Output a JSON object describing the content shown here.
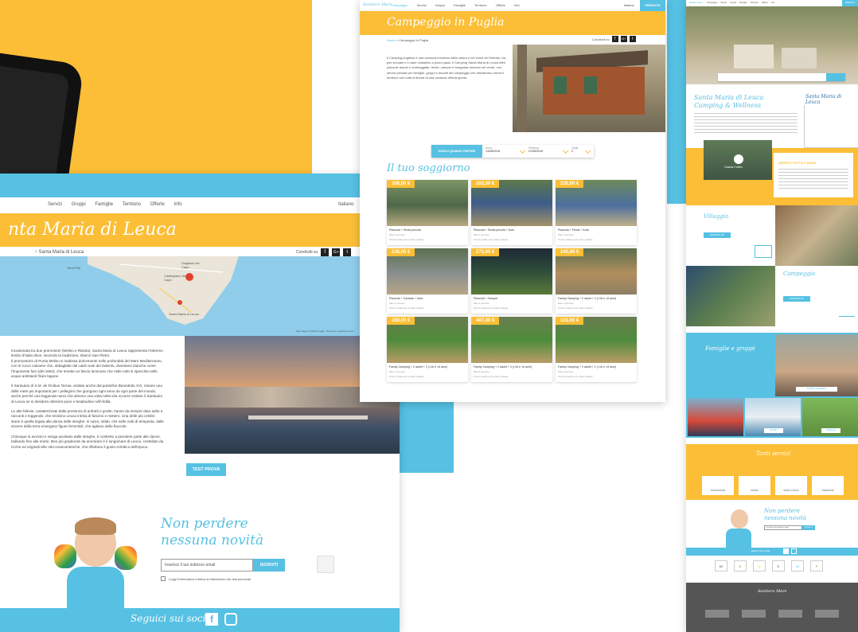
{
  "left": {
    "nav": [
      "Servizi",
      "Gruppi",
      "Famiglie",
      "Territorio",
      "Offerte",
      "Info"
    ],
    "lang": "Italiano",
    "title": "nta Maria di Leuca",
    "breadcrumb": "Santa Maria di Leuca",
    "share": "Condividi su",
    "share_icons": [
      "f",
      "G+",
      "t"
    ],
    "map_labels": [
      "Torre Pali",
      "Gagliano del Capo",
      "Castrignano del Capo",
      "Santa Maria di Leuca"
    ],
    "map_footer": "Dati mappa ©2018 Google · Termini e condizioni d'uso",
    "para1": "Incastonata tra due promontori (Meliso e Ristola), Santa Maria di Leuca rappresenta l'estremo lembo d'Italia dove, secondo la tradizione, sbarcò San Pietro.",
    "para2": "Il promontorio di Punta Meliso si inabissa dolcemente nelle profondità del Mare Mediterraneo, con le rocce calcaree che, abbagliate dal caldo sole del Salento, diventano bianche come l'imponente faro (del 1864), che emette un fascio luminoso che nelle notti si specchia nelle acque antistanti l'ilare lagune.",
    "para3": "Il Santuario di S.M. de Finibus Terrae, visitato anche dal pontefice Benedetto XVI, rimane una delle mete più importanti per i pellegrini che giungono ogni anno da ogni parte del mondo, anche perché una leggenda narra che almeno una volta nella vita occorre visitare il Santuario di Leuca se si desidera ottenere pace e beatitudine nell'Aldilà.",
    "para4": "Le alte falesie, caratterizzate dalla presenza di anfratti e grotte, hanno da sempre dato adito a racconti e leggende, che rendono Leuca intrisa di fascino e mistero. Una delle più celebri storie è quella legata alla danza delle streghe: si narra, infatti, che nelle notti di tempesta, dalle viscere della terra emergano figure femminili, che agitano delle fiaccole.",
    "para5": "Chiunque si avvicini e venga avvistato dalle streghe, è costretto a prendere parte alle danze, ballando fino alla morte. Ben più gradevole da ammirare è il lungomare di Leuca, costellato da ricche ed originali ville otto-novecentesche, che riflettono il gusto eclettico dell'epoca.",
    "test_button": "TEST PROVA",
    "newsletter_title_1": "Non perdere",
    "newsletter_title_2": "nessuna novità",
    "email_placeholder": "Inserisci il tuo indirizzo email",
    "subscribe": "ISCRIVITI",
    "privacy": "Leggi l'informativa relativa al trattamento dei dati personali",
    "social": "Seguici sui social"
  },
  "middle": {
    "logo": "Sentiero Mare",
    "nav": [
      "Campeggio",
      "Servizi",
      "Gruppi",
      "Famiglie",
      "Territorio",
      "Offerte",
      "Info"
    ],
    "lang": "Italiano",
    "book": "PRENOTA",
    "title": "Campeggio in Puglia",
    "breadcrumb_home": "Home",
    "breadcrumb": "Campeggio in Puglia",
    "share": "Condividi su",
    "share_icons": [
      "f",
      "G+",
      "t"
    ],
    "intro": "Il Camping pugliese è una vacanza immersa nella natura e nei suoni del Salento, tra pini secolari e il mare cristallino a pochi passi. Il Camping Santa Maria di Leuca offre piazzole ampie e ombreggiate, tende, camper e bungalow immersi nel verde, con servizi pensati per famiglie, gruppi e amanti del campeggio che desiderano vivere il territorio con tutta la libertà di una vacanza all'aria aperta.",
    "booking_btn": "SCEGLI QUANDO PARTIRE",
    "arrivo_label": "Arrivo",
    "arrivo": "14/08/2018",
    "partenza_label": "Partenza",
    "partenza": "21/08/2018",
    "ospiti_label": "Ospiti",
    "ospiti": "2",
    "section": "Il tuo soggiorno",
    "cards": [
      {
        "price": "308,00 €",
        "name": "Piazzola + Tenda piccola",
        "sub": "Max 2 persone",
        "note": "Prezzo totale per le date indicate"
      },
      {
        "price": "203,00 €",
        "name": "Piazzola + Tenda piccola + Auto",
        "sub": "Max 2 persone",
        "note": "Prezzo totale per le date indicate"
      },
      {
        "price": "230,00 €",
        "name": "Piazzola + Tenda + Auto",
        "sub": "Max 4 persone",
        "note": "Prezzo totale per le date indicate"
      },
      {
        "price": "238,00 €",
        "name": "Piazzola + Caravan + Auto",
        "sub": "Max 4 persone",
        "note": "Prezzo totale per le date indicate"
      },
      {
        "price": "273,00 €",
        "name": "Piazzola + Camper",
        "sub": "Max 4 persone",
        "note": "Prezzo totale per le date indicate"
      },
      {
        "price": "245,00 €",
        "name": "Family Camping + 2 adulti + 2 (<16 e >6 anni)",
        "sub": "Max 4 persone",
        "note": "Prezzo totale per le date indicate"
      },
      {
        "price": "280,00 €",
        "name": "Family Camping + 2 adulti + 2 (<16 e >6 anni)",
        "sub": "Max 4 persone",
        "note": "Prezzo totale per le date indicate"
      },
      {
        "price": "407,00 €",
        "name": "Family Camping + 2 adulti + 3 (<16 e >6 anni)",
        "sub": "Max 5 persone",
        "note": "Prezzo totale per le date indicate"
      },
      {
        "price": "103,00 €",
        "name": "Family Camping + 2 adulti + 1 (<16 e >6 anni)",
        "sub": "Max 3 persone",
        "note": "Prezzo totale per le date indicate"
      }
    ]
  },
  "right": {
    "nav": [
      "Campeggio",
      "Servizi",
      "Gruppi",
      "Famiglie",
      "Territorio",
      "Offerte",
      "Info"
    ],
    "book": "PRENOTA",
    "hero_title_1": "Santa Maria di Leuca",
    "hero_title_2": "Camping & Wellness",
    "logo_script": "Santa Maria di Leuca",
    "video_label": "Guarda il video",
    "apertura": "APERTO TUTTO L'ANNO",
    "villaggio": "Villaggio",
    "villaggio_btn": "SCOPRI DI PIÙ",
    "campeggio": "Campeggio",
    "campeggio_btn": "SCOPRI DI PIÙ",
    "famiglie": "Famiglie e gruppi",
    "fam_btn1": "SCOPRI LE OFFERTE",
    "fam_btn2": "GRUPPI",
    "fam_btn3": "FAMIGLIE",
    "servizi": "Tanti servizi",
    "serv_items": [
      "RISTORAZIONE",
      "PISCINA",
      "SPORT & SVAGO",
      "ANIMAZIONE"
    ],
    "news_1": "Non perdere",
    "news_2": "nessuna novità",
    "email_placeholder": "Inserisci il tuo indirizzo email",
    "subscribe": "ISCRIVITI",
    "social": "Seguici sui social",
    "partners": [
      "60",
      "B",
      "Q",
      "E",
      "W",
      "P"
    ],
    "footer_logo": "Sentiero Mare"
  },
  "colors": {
    "yellow": "#fbbe36",
    "blue": "#56c1e3",
    "dark": "#333333"
  }
}
